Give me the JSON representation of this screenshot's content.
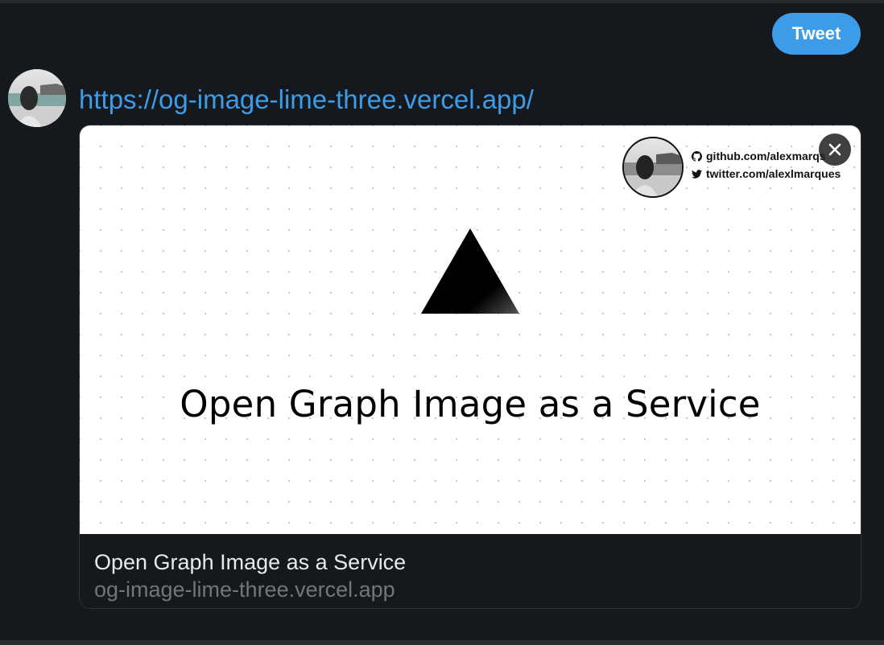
{
  "header": {
    "tweet_button_label": "Tweet"
  },
  "tweet": {
    "url_text": "https://og-image-lime-three.vercel.app/"
  },
  "card": {
    "image": {
      "github_text": "github.com/alexmarqs",
      "twitter_text": "twitter.com/alexlmarques",
      "headline": "Open Graph Image as a Service"
    },
    "title": "Open Graph Image as a Service",
    "domain": "og-image-lime-three.vercel.app"
  },
  "colors": {
    "accent": "#3d9ce8",
    "background": "#15181c",
    "card_border": "#2f3439",
    "muted_text": "#71767b"
  },
  "icons": {
    "close": "close-icon",
    "github": "github-icon",
    "twitter": "twitter-icon",
    "logo": "vercel-triangle-icon"
  }
}
